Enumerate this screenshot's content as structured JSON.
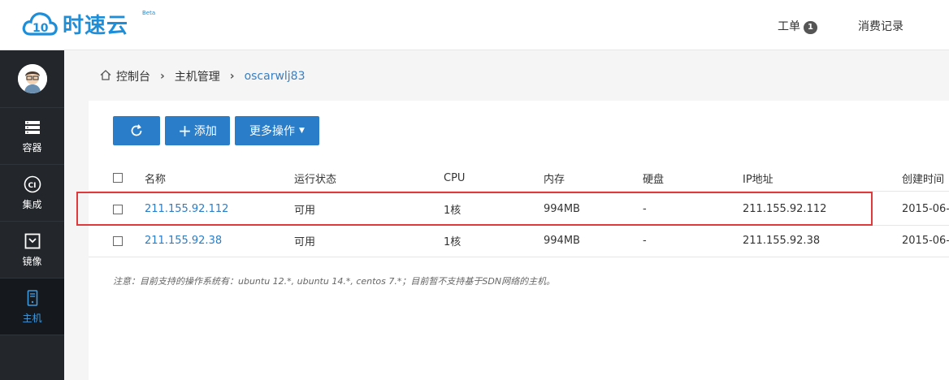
{
  "header": {
    "brand": "时速云",
    "beta": "Beta",
    "tickets_label": "工单",
    "tickets_count": "1",
    "billing_label": "消费记录"
  },
  "sidebar": {
    "items": [
      {
        "label": "容器",
        "icon": "server-stack-icon"
      },
      {
        "label": "集成",
        "icon": "ci-icon"
      },
      {
        "label": "镜像",
        "icon": "image-box-icon"
      },
      {
        "label": "主机",
        "icon": "host-icon",
        "active": true
      }
    ]
  },
  "breadcrumb": [
    "控制台",
    "主机管理",
    "oscarwlj83"
  ],
  "toolbar": {
    "refresh_icon": "refresh-icon",
    "add_label": "添加",
    "more_label": "更多操作"
  },
  "table": {
    "columns": [
      "名称",
      "运行状态",
      "CPU",
      "内存",
      "硬盘",
      "IP地址",
      "创建时间"
    ],
    "rows": [
      {
        "name": "211.155.92.112",
        "status": "可用",
        "cpu": "1核",
        "memory": "994MB",
        "disk": "-",
        "ip": "211.155.92.112",
        "created": "2015-06-"
      },
      {
        "name": "211.155.92.38",
        "status": "可用",
        "cpu": "1核",
        "memory": "994MB",
        "disk": "-",
        "ip": "211.155.92.38",
        "created": "2015-06-"
      }
    ]
  },
  "note": "注意：目前支持的操作系统有：ubuntu 12.*, ubuntu 14.*, centos 7.*；目前暂不支持基于SDN网络的主机。",
  "colors": {
    "accent": "#2a7dc9",
    "sidebar": "#23272c",
    "highlight": "#e0393b"
  }
}
